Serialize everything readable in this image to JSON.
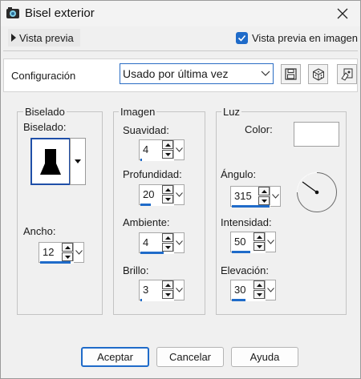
{
  "window": {
    "title": "Bisel exterior"
  },
  "preview": {
    "toggle_label": "Vista previa",
    "checkbox_label": "Vista previa en imagen",
    "checked": true
  },
  "config": {
    "label": "Configuración",
    "preset_value": "Usado por última vez"
  },
  "bevel_group": {
    "title": "Biselado",
    "bevel_label": "Biselado:",
    "width_label": "Ancho:",
    "width_value": "12",
    "width_fill": 0.9
  },
  "image_group": {
    "title": "Imagen",
    "smoothness": {
      "label": "Suavidad:",
      "value": "4",
      "fill": 0.05
    },
    "depth": {
      "label": "Profundidad:",
      "value": "20",
      "fill": 0.3
    },
    "ambience": {
      "label": "Ambiente:",
      "value": "4",
      "fill": 0.7
    },
    "shininess": {
      "label": "Brillo:",
      "value": "3",
      "fill": 0.05
    }
  },
  "light_group": {
    "title": "Luz",
    "color_label": "Color:",
    "color_value": "#ffffff",
    "angle": {
      "label": "Ángulo:",
      "value": "315",
      "fill": 0.98
    },
    "intensity": {
      "label": "Intensidad:",
      "value": "50",
      "fill": 0.55
    },
    "elevation": {
      "label": "Elevación:",
      "value": "30",
      "fill": 0.4
    }
  },
  "buttons": {
    "ok": "Aceptar",
    "cancel": "Cancelar",
    "help": "Ayuda"
  },
  "colors": {
    "accent": "#1f6bc9"
  }
}
